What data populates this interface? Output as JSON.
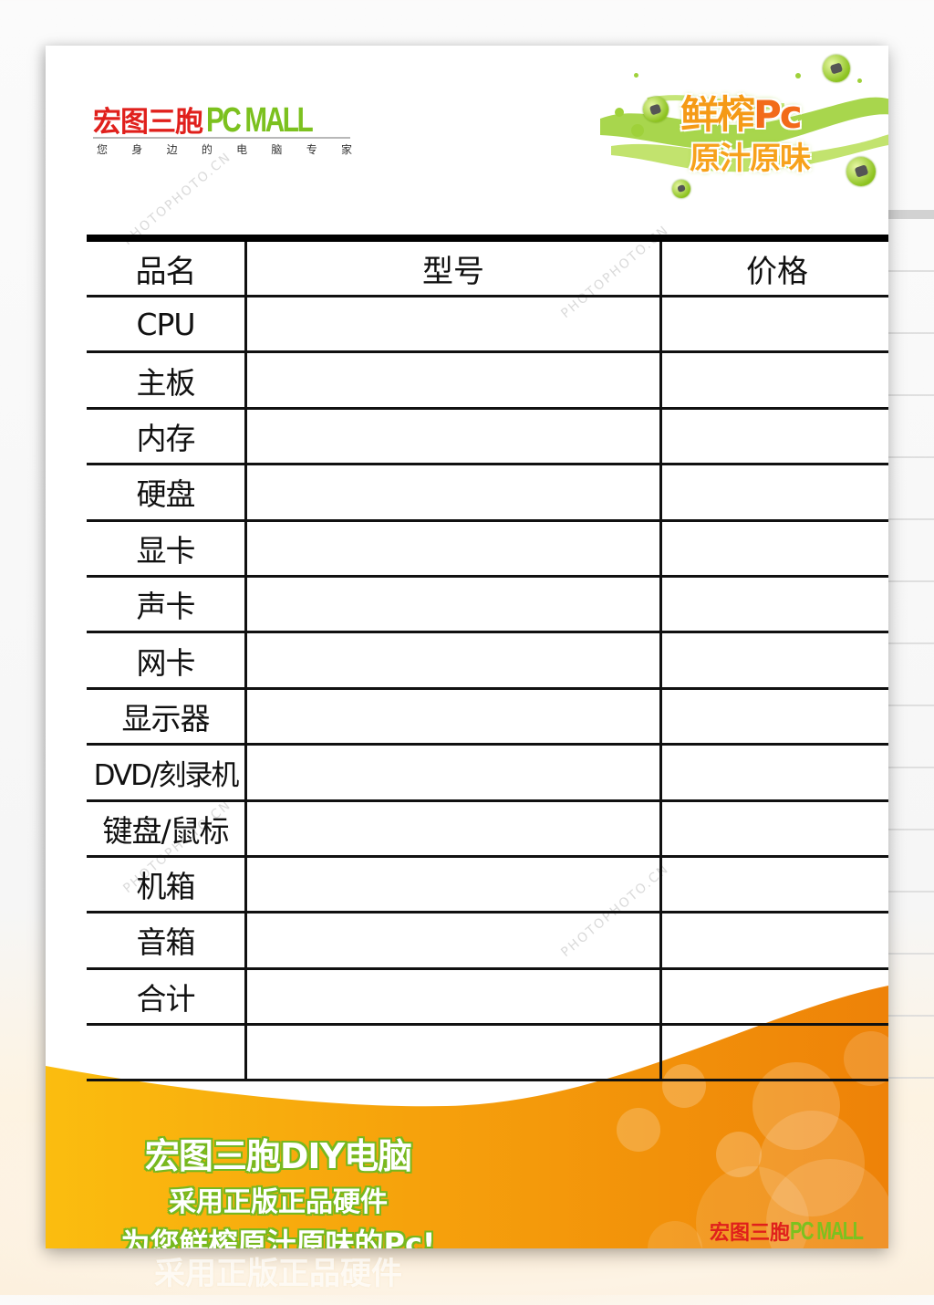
{
  "brand": {
    "name_cn": "宏图三胞",
    "name_en": "PC MALL",
    "tagline_chars": [
      "您",
      "身",
      "边",
      "的",
      "电",
      "脑",
      "专",
      "家"
    ],
    "colors": {
      "red": "#e0201c",
      "green": "#7cc11f",
      "orange": "#f39c12"
    }
  },
  "splash": {
    "line1": "鲜榨",
    "line1_pc": "Pc",
    "line2": "原汁原味"
  },
  "watermark": {
    "text": "PHOTOPHOTO.CN"
  },
  "table": {
    "headers": [
      "品名",
      "型号",
      "价格"
    ],
    "rows": [
      {
        "name": "CPU",
        "model": "",
        "price": ""
      },
      {
        "name": "主板",
        "model": "",
        "price": ""
      },
      {
        "name": "内存",
        "model": "",
        "price": ""
      },
      {
        "name": "硬盘",
        "model": "",
        "price": ""
      },
      {
        "name": "显卡",
        "model": "",
        "price": ""
      },
      {
        "name": "声卡",
        "model": "",
        "price": ""
      },
      {
        "name": "网卡",
        "model": "",
        "price": ""
      },
      {
        "name": "显示器",
        "model": "",
        "price": ""
      },
      {
        "name": "DVD/刻录机",
        "model": "",
        "price": ""
      },
      {
        "name": "键盘/鼠标",
        "model": "",
        "price": ""
      },
      {
        "name": "机箱",
        "model": "",
        "price": ""
      },
      {
        "name": "音箱",
        "model": "",
        "price": ""
      },
      {
        "name": "合计",
        "model": "",
        "price": ""
      },
      {
        "name": "",
        "model": "",
        "price": ""
      }
    ]
  },
  "footer": {
    "slogan_1": "宏图三胞DIY电脑",
    "slogan_2": "采用正版正品硬件",
    "slogan_3": "为您鲜榨原汁原味的Pc!",
    "logo_cn": "宏图三胞",
    "logo_en": "PC MALL",
    "reflection": "采用正版正品硬件"
  }
}
